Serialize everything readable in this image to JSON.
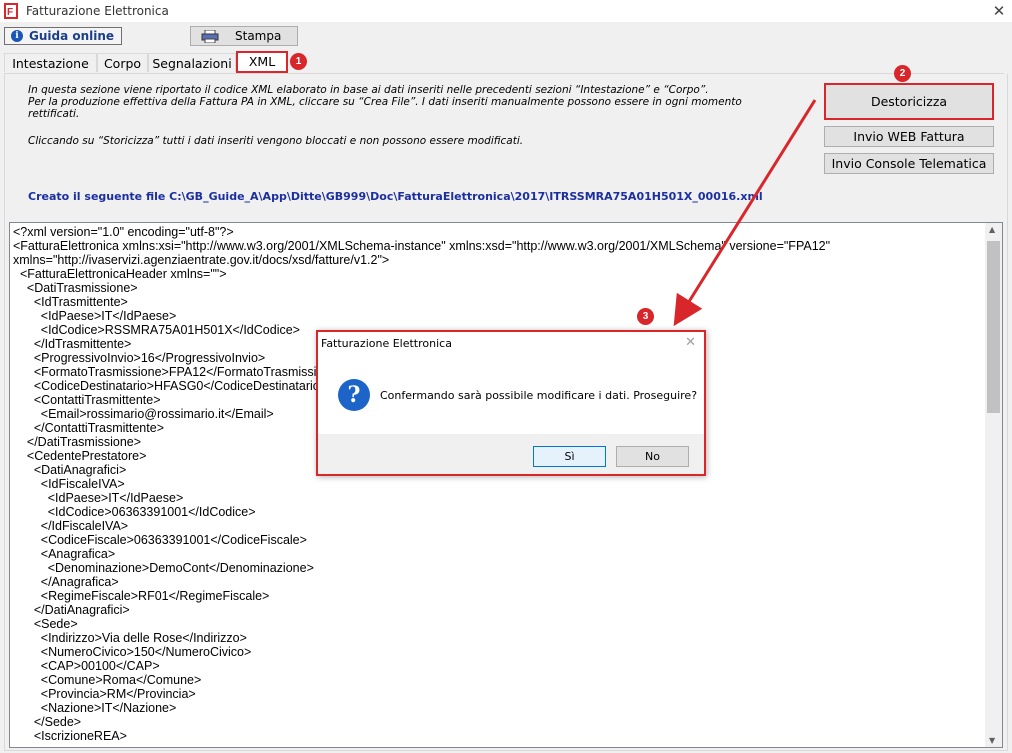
{
  "window": {
    "title": "Fatturazione Elettronica",
    "close_glyph": "✕"
  },
  "toolbar": {
    "guida_label": "Guida online",
    "stampa_label": "Stampa"
  },
  "tabs": [
    {
      "label": "Intestazione"
    },
    {
      "label": "Corpo"
    },
    {
      "label": "Segnalazioni"
    },
    {
      "label": "XML",
      "active": true
    }
  ],
  "badges": [
    "1",
    "2",
    "3"
  ],
  "info": {
    "line1": "In questa sezione viene riportato il codice XML elaborato in base ai dati inseriti nelle precedenti sezioni “Intestazione” e “Corpo”.",
    "line2": "Per la produzione effettiva della Fattura PA in XML, cliccare su “Crea File”. I dati inseriti manualmente possono essere in ogni momento",
    "line3": "rettificati.",
    "line4": "Cliccando su “Storicizza” tutti i dati inseriti vengono bloccati e non possono essere modificati."
  },
  "created_file": "Creato il seguente file C:\\GB_Guide_A\\App\\Ditte\\GB999\\Doc\\FatturaElettronica\\2017\\ITRSSMRA75A01H501X_00016.xml",
  "buttons": {
    "destoricizza": "Destoricizza",
    "invio_web": "Invio WEB Fattura",
    "invio_console": "Invio Console Telematica"
  },
  "xml_lines": [
    "<?xml version=\"1.0\" encoding=\"utf-8\"?>",
    "<FatturaElettronica xmlns:xsi=\"http://www.w3.org/2001/XMLSchema-instance\" xmlns:xsd=\"http://www.w3.org/2001/XMLSchema\" versione=\"FPA12\"",
    "xmlns=\"http://ivaservizi.agenziaentrate.gov.it/docs/xsd/fatture/v1.2\">",
    "  <FatturaElettronicaHeader xmlns=\"\">",
    "    <DatiTrasmissione>",
    "      <IdTrasmittente>",
    "        <IdPaese>IT</IdPaese>",
    "        <IdCodice>RSSMRA75A01H501X</IdCodice>",
    "      </IdTrasmittente>",
    "      <ProgressivoInvio>16</ProgressivoInvio>",
    "      <FormatoTrasmissione>FPA12</FormatoTrasmissione>",
    "      <CodiceDestinatario>HFASG0</CodiceDestinatario>",
    "      <ContattiTrasmittente>",
    "        <Email>rossimario@rossimario.it</Email>",
    "      </ContattiTrasmittente>",
    "    </DatiTrasmissione>",
    "    <CedentePrestatore>",
    "      <DatiAnagrafici>",
    "        <IdFiscaleIVA>",
    "          <IdPaese>IT</IdPaese>",
    "          <IdCodice>06363391001</IdCodice>",
    "        </IdFiscaleIVA>",
    "        <CodiceFiscale>06363391001</CodiceFiscale>",
    "        <Anagrafica>",
    "          <Denominazione>DemoCont</Denominazione>",
    "        </Anagrafica>",
    "        <RegimeFiscale>RF01</RegimeFiscale>",
    "      </DatiAnagrafici>",
    "      <Sede>",
    "        <Indirizzo>Via delle Rose</Indirizzo>",
    "        <NumeroCivico>150</NumeroCivico>",
    "        <CAP>00100</CAP>",
    "        <Comune>Roma</Comune>",
    "        <Provincia>RM</Provincia>",
    "        <Nazione>IT</Nazione>",
    "      </Sede>",
    "      <IscrizioneREA>"
  ],
  "dialog": {
    "title": "Fatturazione Elettronica",
    "message": "Confermando sarà possibile modificare i dati. Proseguire?",
    "yes_label": "Sì",
    "no_label": "No",
    "close_glyph": "✕",
    "icon_glyph": "?"
  },
  "colors": {
    "accent_red": "#d9262b",
    "link_blue": "#1b2fa0",
    "question_blue": "#1c64c8"
  }
}
